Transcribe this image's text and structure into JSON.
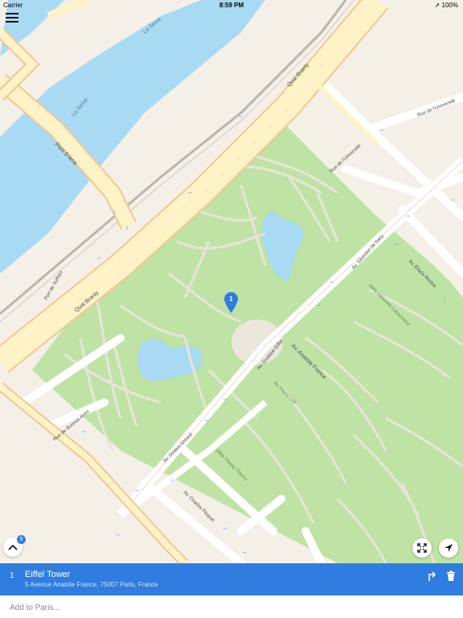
{
  "status_bar": {
    "carrier": "Carrier",
    "time": "8:59 PM",
    "battery": "100%"
  },
  "map": {
    "pin_number": "1",
    "street_labels": {
      "la_seine_1": "La Seine",
      "la_seine_2": "La Seine",
      "pont_diena": "Pont D'iena",
      "quai_branly_1": "Quai Branly",
      "quai_branly_2": "Quai Branly",
      "port_de_suffren": "Port de Suffren",
      "rue_universite_1": "Rue de l'Université",
      "rue_universite_2": "Rue de l'Université",
      "av_elisee_reclus": "Av. Élisée Reclus",
      "av_gustave_eiffel": "Av. Gustave Eiffel",
      "av_anatole_france": "Av. Anatole France",
      "av_octave_greard": "Av. Octave Gréard",
      "av_charles_floquet": "Av. Charles Floquet",
      "rue_buenos_aires": "Rue de Buenos Aires",
      "allee_thomy_thierry": "Allée Thomy Thierry",
      "av_silvestre_de_sacy": "Av. Silvestre de Sacy"
    }
  },
  "controls": {
    "collapse_icon": "chevron-up-icon",
    "collapse_badge": "5",
    "fit_icon": "expand-icon",
    "locate_icon": "location-arrow-icon"
  },
  "stop": {
    "index": "1",
    "name": "Eiffel Tower",
    "address": "5 Avenue Anatole France, 75007 Paris, France",
    "directions_icon": "directions-icon",
    "delete_icon": "trash-icon"
  },
  "add_field": {
    "placeholder": "Add to Paris..."
  },
  "colors": {
    "accent": "#2f7de1",
    "park": "#bfe3a5",
    "water": "#a8daf3",
    "road_major": "#fdf3c6"
  }
}
